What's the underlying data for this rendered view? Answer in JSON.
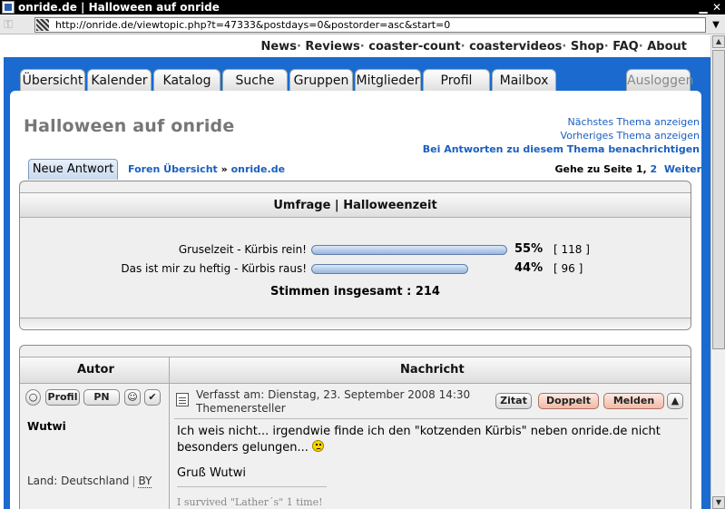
{
  "window": {
    "title": "onride.de | Halloween auf onride",
    "url": "http://onride.de/viewtopic.php?t=47333&postdays=0&postorder=asc&start=0"
  },
  "topnav": [
    "News",
    "Reviews",
    "coaster-count",
    "coastervideos",
    "Shop",
    "FAQ",
    "About"
  ],
  "tabs": [
    "Übersicht",
    "Kalender",
    "Katalog",
    "Suche",
    "Gruppen",
    "Mitglieder",
    "Profil",
    "Mailbox"
  ],
  "logout": "Ausloggen",
  "page": {
    "title": "Halloween auf onride",
    "next_topic": "Nächstes Thema anzeigen",
    "prev_topic": "Vorheriges Thema anzeigen",
    "notify": "Bei Antworten zu diesem Thema benachrichtigen",
    "new_reply": "Neue Antwort",
    "crumb_forum": "Foren Übersicht",
    "crumb_sep": "»",
    "crumb_site": "onride.de",
    "goto_label": "Gehe zu Seite",
    "goto_current": "1,",
    "goto_page2": "2",
    "goto_next": "Weiter"
  },
  "poll": {
    "title": "Umfrage | Halloweenzeit",
    "options": [
      {
        "label": "Gruselzeit - Kürbis rein!",
        "percent": 55,
        "percent_text": "55%",
        "votes_text": "[ 118 ]"
      },
      {
        "label": "Das ist mir zu heftig - Kürbis raus!",
        "percent": 44,
        "percent_text": "44%",
        "votes_text": "[ 96 ]"
      }
    ],
    "total": "Stimmen insgesamt : 214"
  },
  "post": {
    "col_author": "Autor",
    "col_message": "Nachricht",
    "user_buttons": [
      "Profil",
      "PN"
    ],
    "username": "Wutwi",
    "land_label": "Land: Deutschland",
    "land_code": "BY",
    "meta_line1": "Verfasst am: Dienstag, 23. September 2008 14:30",
    "meta_line2": "Themenersteller",
    "btn_quote": "Zitat",
    "btn_double": "Doppelt",
    "btn_report": "Melden",
    "body": "Ich weis nicht... irgendwie finde ich den \"kotzenden Kürbis\" neben onride.de nicht besonders gelungen...",
    "greeting": "Gruß Wutwi",
    "signature": "I survived \"Lather´s\" 1 time!"
  }
}
